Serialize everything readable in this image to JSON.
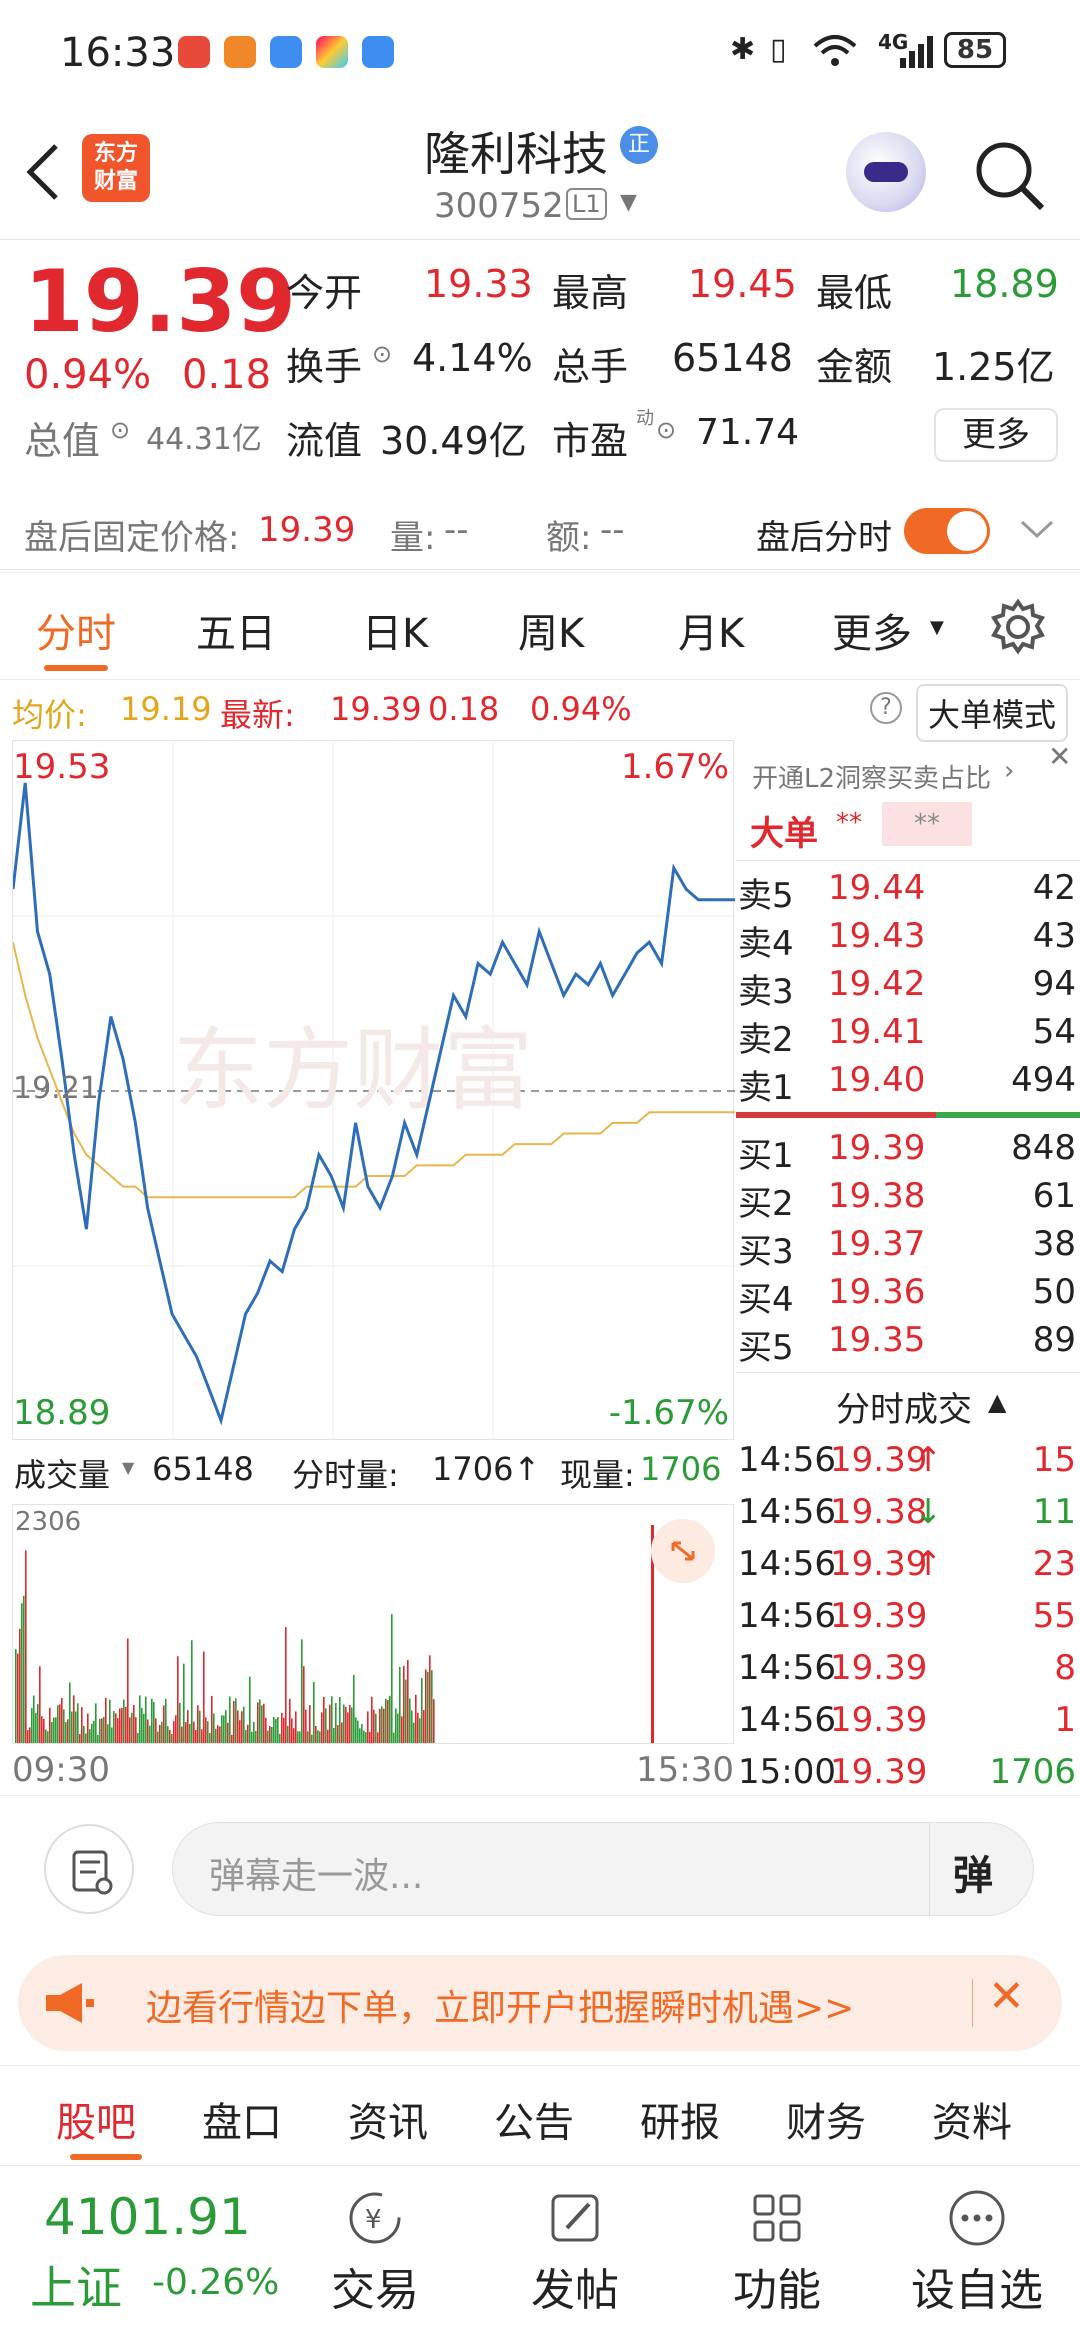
{
  "status_bar": {
    "time": "16:33",
    "network": "4G",
    "battery": "85"
  },
  "header": {
    "stock_name": "隆利科技",
    "name_badge": "正",
    "stock_code": "300752",
    "level_badge": "L1",
    "logo_text_1": "东方",
    "logo_text_2": "财富"
  },
  "quote": {
    "price": "19.39",
    "change_pct": "0.94%",
    "change_amt": "0.18",
    "open_label": "今开",
    "open": "19.33",
    "high_label": "最高",
    "high": "19.45",
    "low_label": "最低",
    "low": "18.89",
    "turnover_label": "换手",
    "turnover": "4.14%",
    "volume_label": "总手",
    "volume": "65148",
    "amount_label": "金额",
    "amount": "1.25亿",
    "mktcap_label": "总值",
    "mktcap": "44.31亿",
    "float_label": "流值",
    "float_cap": "30.49亿",
    "pe_label": "市盈",
    "pe_super": "动",
    "pe": "71.74",
    "more_button": "更多"
  },
  "after_hours": {
    "price_label": "盘后固定价格:",
    "price": "19.39",
    "vol_label": "量:",
    "vol": "--",
    "amt_label": "额:",
    "amt": "--",
    "toggle_label": "盘后分时",
    "toggle_on": true
  },
  "chart_tabs": [
    "分时",
    "五日",
    "日K",
    "周K",
    "月K",
    "更多"
  ],
  "chart_header": {
    "avg_label": "均价:",
    "avg": "19.19",
    "last_label": "最新:",
    "last": "19.39",
    "chg": "0.18",
    "pct": "0.94%",
    "big_order_button": "大单模式"
  },
  "chart_data": {
    "type": "line",
    "y_top": "19.53",
    "y_top_pct": "1.67%",
    "y_bottom": "18.89",
    "y_bottom_pct": "-1.67%",
    "y_mid": "19.21",
    "watermark": "东方财富",
    "ylim": [
      18.89,
      19.53
    ],
    "price_series": [
      19.4,
      19.5,
      19.36,
      19.32,
      19.24,
      19.15,
      19.08,
      19.2,
      19.28,
      19.24,
      19.18,
      19.1,
      19.05,
      19.0,
      18.98,
      18.96,
      18.93,
      18.9,
      18.95,
      19.0,
      19.02,
      19.05,
      19.04,
      19.08,
      19.1,
      19.15,
      19.13,
      19.1,
      19.18,
      19.12,
      19.1,
      19.13,
      19.18,
      19.15,
      19.2,
      19.25,
      19.3,
      19.28,
      19.33,
      19.32,
      19.35,
      19.33,
      19.31,
      19.36,
      19.33,
      19.3,
      19.32,
      19.31,
      19.33,
      19.3,
      19.32,
      19.34,
      19.35,
      19.33,
      19.42,
      19.4,
      19.39,
      19.39,
      19.39,
      19.39
    ],
    "avg_series": [
      19.35,
      19.3,
      19.26,
      19.23,
      19.2,
      19.17,
      19.15,
      19.14,
      19.13,
      19.12,
      19.12,
      19.11,
      19.11,
      19.11,
      19.11,
      19.11,
      19.11,
      19.11,
      19.11,
      19.11,
      19.11,
      19.11,
      19.11,
      19.11,
      19.12,
      19.12,
      19.12,
      19.12,
      19.12,
      19.13,
      19.13,
      19.13,
      19.13,
      19.14,
      19.14,
      19.14,
      19.14,
      19.15,
      19.15,
      19.15,
      19.15,
      19.16,
      19.16,
      19.16,
      19.16,
      19.17,
      19.17,
      19.17,
      19.17,
      19.18,
      19.18,
      19.18,
      19.19,
      19.19,
      19.19,
      19.19,
      19.19,
      19.19,
      19.19,
      19.19
    ]
  },
  "order_book": {
    "promo_link": "开通L2洞察买卖占比",
    "big_label": "大单",
    "big_v1": "**",
    "big_v2": "**",
    "asks": [
      {
        "label": "卖5",
        "price": "19.44",
        "vol": "42"
      },
      {
        "label": "卖4",
        "price": "19.43",
        "vol": "43"
      },
      {
        "label": "卖3",
        "price": "19.42",
        "vol": "94"
      },
      {
        "label": "卖2",
        "price": "19.41",
        "vol": "54"
      },
      {
        "label": "卖1",
        "price": "19.40",
        "vol": "494"
      }
    ],
    "bids": [
      {
        "label": "买1",
        "price": "19.39",
        "vol": "848"
      },
      {
        "label": "买2",
        "price": "19.38",
        "vol": "61"
      },
      {
        "label": "买3",
        "price": "19.37",
        "vol": "38"
      },
      {
        "label": "买4",
        "price": "19.36",
        "vol": "50"
      },
      {
        "label": "买5",
        "price": "19.35",
        "vol": "89"
      }
    ]
  },
  "ticks": {
    "title": "分时成交",
    "rows": [
      {
        "time": "14:56",
        "price": "19.39",
        "arrow": "↑",
        "vol": "15",
        "vol_color": "red"
      },
      {
        "time": "14:56",
        "price": "19.38",
        "arrow": "↓",
        "vol": "11",
        "vol_color": "green"
      },
      {
        "time": "14:56",
        "price": "19.39",
        "arrow": "↑",
        "vol": "23",
        "vol_color": "red"
      },
      {
        "time": "14:56",
        "price": "19.39",
        "arrow": "",
        "vol": "55",
        "vol_color": "red"
      },
      {
        "time": "14:56",
        "price": "19.39",
        "arrow": "",
        "vol": "8",
        "vol_color": "red"
      },
      {
        "time": "14:56",
        "price": "19.39",
        "arrow": "",
        "vol": "1",
        "vol_color": "red"
      },
      {
        "time": "15:00",
        "price": "19.39",
        "arrow": "",
        "vol": "1706",
        "vol_color": "green"
      }
    ]
  },
  "volume": {
    "label": "成交量",
    "total": "65148",
    "minute_label": "分时量:",
    "minute_vol": "1706↑",
    "current_label": "现量:",
    "current_vol": "1706",
    "ymax": "2306",
    "x_start": "09:30",
    "x_end": "15:30"
  },
  "chat": {
    "placeholder": "弹幕走一波...",
    "send_label": "弹"
  },
  "promo": {
    "text": "边看行情边下单，立即开户把握瞬时机遇>>"
  },
  "bottom_tabs": [
    "股吧",
    "盘口",
    "资讯",
    "公告",
    "研报",
    "财务",
    "资料"
  ],
  "bottom_nav": {
    "index_value": "4101.91",
    "index_name": "上证",
    "index_change": "-0.26%",
    "items": [
      "交易",
      "发帖",
      "功能",
      "设自选"
    ]
  }
}
